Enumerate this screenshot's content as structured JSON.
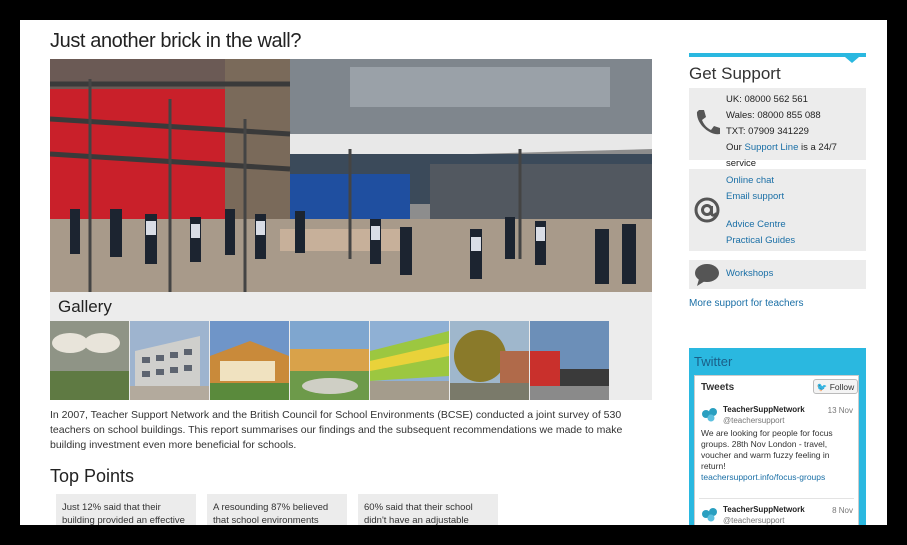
{
  "page": {
    "title": "Just another brick in the wall?",
    "gallery_title": "Gallery",
    "summary": "In 2007, Teacher Support Network and the British Council for School Environments (BCSE) conducted a joint survey of 530 teachers on school buildings. This report summarises our findings and the subsequent recommendations we made to make building investment even more beneficial for schools.",
    "top_points_title": "Top Points",
    "top_points": [
      "Just 12% said that their building provided an effective",
      "A resounding 87% believed that school environments",
      "60% said that their school didn't have an adjustable"
    ]
  },
  "sidebar": {
    "title": "Get Support",
    "phone_lines": [
      "UK: 08000 562 561",
      "Wales: 08000 855 088",
      "TXT: 07909 341229"
    ],
    "support_line_prefix": "Our ",
    "support_line_link": "Support Line",
    "support_line_suffix": " is a 24/7 service",
    "online_chat": "Online chat",
    "email_support": "Email support",
    "advice_centre": "Advice Centre",
    "practical_guides": "Practical Guides",
    "workshops": "Workshops",
    "more_support": "More support for teachers"
  },
  "twitter": {
    "title": "Twitter",
    "tweets_label": "Tweets",
    "follow_label": "Follow",
    "tweets": [
      {
        "name": "TeacherSuppNetwork",
        "handle": "@teachersupport",
        "date": "13 Nov",
        "text": "We are looking for people for focus groups. 28th Nov London - travel, voucher and warm fuzzy feeling in return!",
        "link": "teachersupport.info/focus-groups"
      },
      {
        "name": "TeacherSuppNetwork",
        "handle": "@teachersupport",
        "date": "8 Nov",
        "text": "",
        "link": ""
      }
    ]
  },
  "colors": {
    "accent": "#2ab8e0",
    "link": "#1a6fa6",
    "panel": "#ececec"
  },
  "icons": [
    "phone-icon",
    "at-icon",
    "speech-bubble-icon",
    "twitter-bird-icon"
  ]
}
